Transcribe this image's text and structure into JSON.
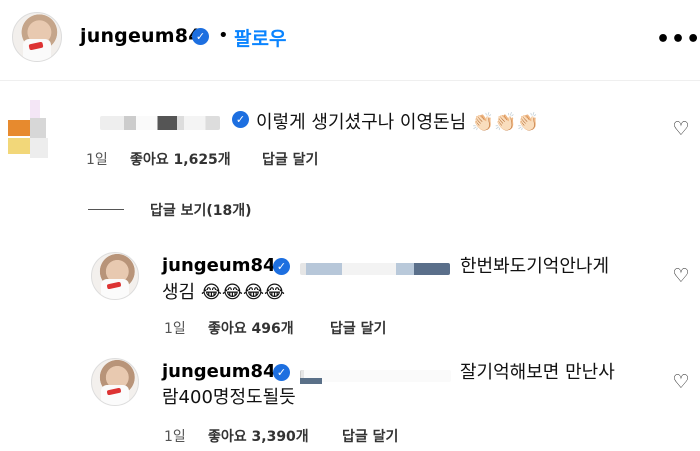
{
  "header": {
    "username": "jungeum84",
    "separator": "•",
    "follow_label": "팔로우",
    "more_icon": "more-horizontal-icon"
  },
  "comment": {
    "text": "이렇게 생기셨구나 이영돈님",
    "emoji": [
      "👏🏻",
      "👏🏻",
      "👏🏻"
    ],
    "time": "1일",
    "likes": "좋아요 1,625개",
    "reply_label": "답글 달기"
  },
  "replies_toggle": "답글 보기(18개)",
  "replies": [
    {
      "username": "jungeum84",
      "text_line1": "한번봐도기억안나게",
      "text_line2": "생김",
      "emoji": [
        "😂",
        "😂",
        "😂",
        "😂"
      ],
      "time": "1일",
      "likes": "좋아요 496개",
      "reply_label": "답글 달기"
    },
    {
      "username": "jungeum84",
      "text_line1": "잘기억해보면 만난사",
      "text_line2": "람400명정도될듯",
      "time": "1일",
      "likes": "좋아요 3,390개",
      "reply_label": "답글 달기"
    }
  ],
  "colors": {
    "accent": "#0a84ff",
    "verified": "#1d6fe0"
  }
}
